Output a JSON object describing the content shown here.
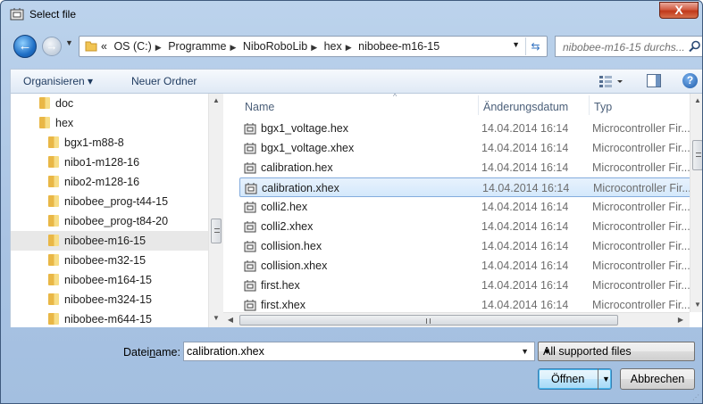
{
  "window": {
    "title": "Select file",
    "close_label": "X"
  },
  "nav": {
    "breadcrumb_prefix": "«",
    "crumbs": [
      "OS (C:)",
      "Programme",
      "NiboRoboLib",
      "hex",
      "nibobee-m16-15"
    ],
    "separator": "▶",
    "search_placeholder": "nibobee-m16-15 durchs..."
  },
  "toolbar": {
    "organize": "Organisieren ▾",
    "new_folder": "Neuer Ordner",
    "help": "?"
  },
  "tree": {
    "items": [
      {
        "label": "doc"
      },
      {
        "label": "hex"
      },
      {
        "label": "bgx1-m88-8"
      },
      {
        "label": "nibo1-m128-16"
      },
      {
        "label": "nibo2-m128-16"
      },
      {
        "label": "nibobee_prog-t44-15"
      },
      {
        "label": "nibobee_prog-t84-20"
      },
      {
        "label": "nibobee-m16-15"
      },
      {
        "label": "nibobee-m32-15"
      },
      {
        "label": "nibobee-m164-15"
      },
      {
        "label": "nibobee-m324-15"
      },
      {
        "label": "nibobee-m644-15"
      }
    ],
    "selected_index": 7
  },
  "files": {
    "columns": {
      "name": "Name",
      "date": "Änderungsdatum",
      "type": "Typ"
    },
    "rows": [
      {
        "name": "bgx1_voltage.hex",
        "date": "14.04.2014 16:14",
        "type": "Microcontroller Fir..."
      },
      {
        "name": "bgx1_voltage.xhex",
        "date": "14.04.2014 16:14",
        "type": "Microcontroller Fir..."
      },
      {
        "name": "calibration.hex",
        "date": "14.04.2014 16:14",
        "type": "Microcontroller Fir..."
      },
      {
        "name": "calibration.xhex",
        "date": "14.04.2014 16:14",
        "type": "Microcontroller Fir..."
      },
      {
        "name": "colli2.hex",
        "date": "14.04.2014 16:14",
        "type": "Microcontroller Fir..."
      },
      {
        "name": "colli2.xhex",
        "date": "14.04.2014 16:14",
        "type": "Microcontroller Fir..."
      },
      {
        "name": "collision.hex",
        "date": "14.04.2014 16:14",
        "type": "Microcontroller Fir..."
      },
      {
        "name": "collision.xhex",
        "date": "14.04.2014 16:14",
        "type": "Microcontroller Fir..."
      },
      {
        "name": "first.hex",
        "date": "14.04.2014 16:14",
        "type": "Microcontroller Fir..."
      },
      {
        "name": "first.xhex",
        "date": "14.04.2014 16:14",
        "type": "Microcontroller Fir..."
      }
    ],
    "selected_index": 3
  },
  "footer": {
    "filename_label_pre": "Datei",
    "filename_label_u": "n",
    "filename_label_post": "ame:",
    "filename_value": "calibration.xhex",
    "filetype_value": "All supported files",
    "open_label": "Öffnen",
    "cancel_label": "Abbrechen"
  },
  "colors": {
    "selection": "#d4e8fb",
    "selection_border": "#84acdd",
    "frame": "#a9c3e3"
  }
}
